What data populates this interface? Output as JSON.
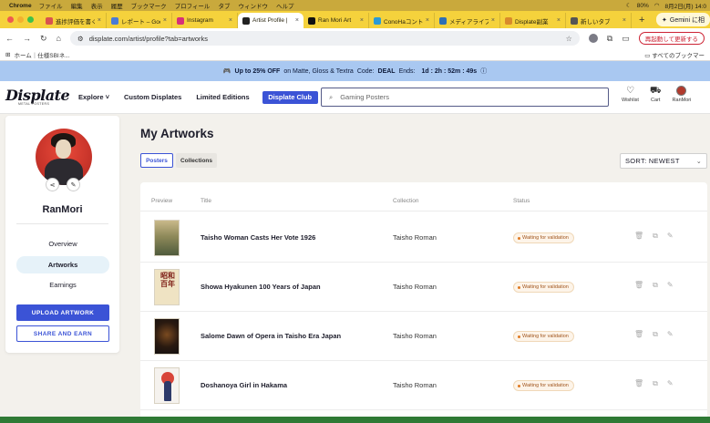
{
  "os_menubar": {
    "app": "Chrome",
    "items": [
      "ファイル",
      "編集",
      "表示",
      "履歴",
      "ブックマーク",
      "プロフィール",
      "タブ",
      "ウィンドウ",
      "ヘルプ"
    ],
    "battery": "80%",
    "datetime": "8月2日(月) 14:0"
  },
  "browser": {
    "tabs": [
      {
        "title": "進捗評価を書く",
        "color": "#d9534f"
      },
      {
        "title": "レポート – Goo",
        "color": "#4a7bd6"
      },
      {
        "title": "Instagram",
        "color": "#d6307a"
      },
      {
        "title": "Artist Profile |",
        "color": "#222222"
      },
      {
        "title": "Ran Mori Art",
        "color": "#111111"
      },
      {
        "title": "ConoHaコント",
        "color": "#2b9ad6"
      },
      {
        "title": "メディアライブ",
        "color": "#2f6fb3"
      },
      {
        "title": "Displate副業",
        "color": "#d98a2b"
      },
      {
        "title": "新しいタブ",
        "color": "#555555"
      }
    ],
    "gemini_label": "Gemini に相",
    "url": "displate.com/artist/profile?tab=artworks",
    "update_button": "再起動して更新する",
    "bookmarks": [
      "ホーム｜仕様SBIネ..."
    ],
    "all_bookmarks": "すべてのブックマー"
  },
  "promo": {
    "text": "Up to 25% OFF",
    "rest": "on Matte, Gloss & Textra",
    "code_label": "Code:",
    "code": "DEAL",
    "ends_label": "Ends:",
    "countdown": "1d : 2h : 52m : 49s"
  },
  "header": {
    "logo": "Displate",
    "logo_sub": "METAL POSTERS",
    "nav": [
      "Explore",
      "Custom Displates",
      "Limited Editions"
    ],
    "club_button": "Displate Club",
    "search_placeholder": "Gaming Posters",
    "icons": [
      {
        "label": "Wishlist",
        "icon": "heart-icon"
      },
      {
        "label": "Cart",
        "icon": "cart-icon"
      },
      {
        "label": "RanMori",
        "icon": "avatar"
      }
    ]
  },
  "sidebar": {
    "username": "RanMori",
    "nav": [
      {
        "label": "Overview",
        "active": false
      },
      {
        "label": "Artworks",
        "active": true
      },
      {
        "label": "Earnings",
        "active": false
      }
    ],
    "upload_button": "UPLOAD ARTWORK",
    "share_button": "SHARE AND EARN"
  },
  "main": {
    "title": "My Artworks",
    "tabs": [
      "Posters",
      "Collections"
    ],
    "sort": "SORT: NEWEST",
    "columns": [
      "Preview",
      "Title",
      "Collection",
      "Status"
    ],
    "rows": [
      {
        "title": "Taisho Woman Casts Her Vote 1926",
        "collection": "Taisho Roman",
        "status": "Waiting for validation"
      },
      {
        "title": "Showa Hyakunen 100 Years of Japan",
        "collection": "Taisho Roman",
        "status": "Waiting for validation"
      },
      {
        "title": "Salome Dawn of Opera in Taisho Era Japan",
        "collection": "Taisho Roman",
        "status": "Waiting for validation"
      },
      {
        "title": "Doshanoya Girl in Hakama",
        "collection": "Taisho Roman",
        "status": "Waiting for validation"
      }
    ],
    "thumb_text_row2": "昭和百年"
  }
}
